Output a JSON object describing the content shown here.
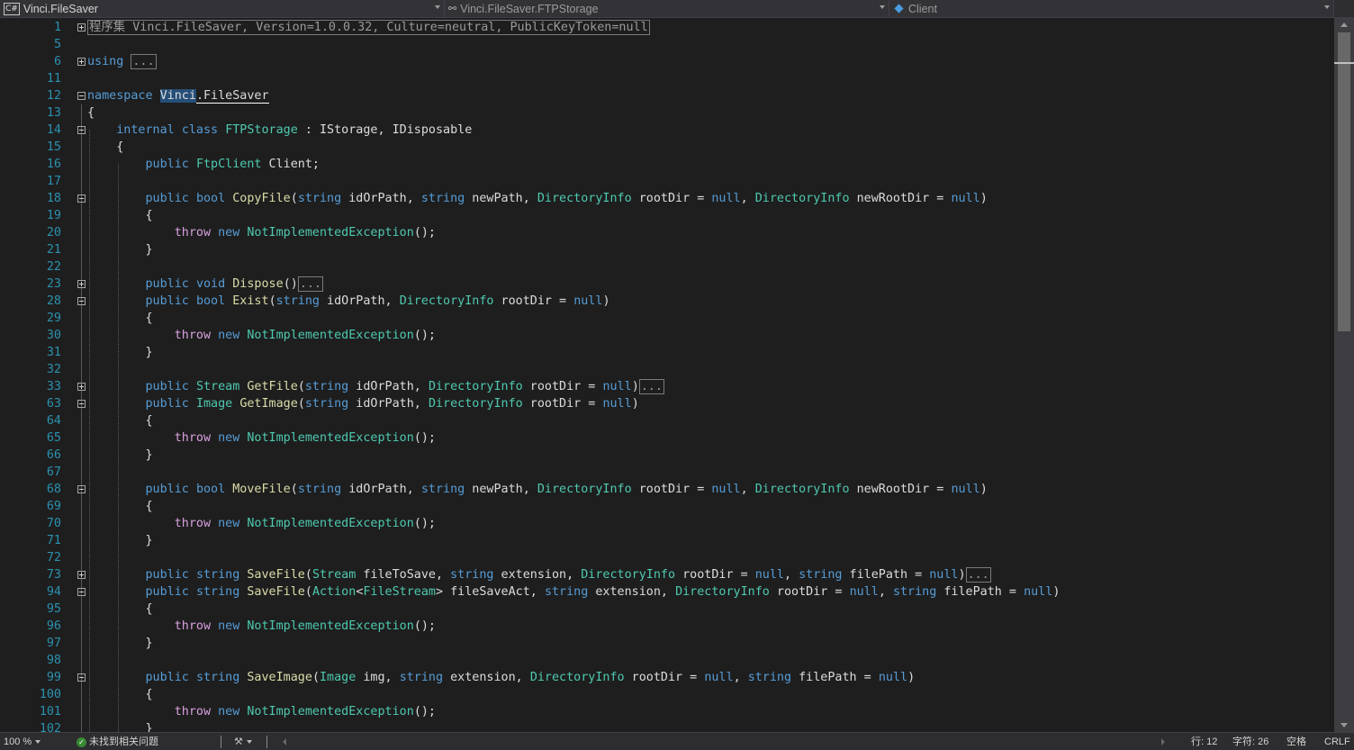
{
  "nav": {
    "project": "Vinci.FileSaver",
    "type": "Vinci.FileSaver.FTPStorage",
    "member": "Client",
    "project_icon": "csharp-project-icon",
    "type_icon": "class-icon",
    "member_icon": "field-icon"
  },
  "code_lines": [
    {
      "n": "1",
      "fold": "plus",
      "tokens": [
        {
          "t": "程序集 Vinci.FileSaver, Version=1.0.0.32, Culture=neutral, PublicKeyToken=null",
          "c": "box"
        }
      ]
    },
    {
      "n": "5",
      "tokens": []
    },
    {
      "n": "6",
      "fold": "plus",
      "tokens": [
        {
          "t": "using",
          "c": "kw"
        },
        {
          "t": " ",
          "c": "plain"
        },
        {
          "t": "...",
          "c": "box"
        }
      ]
    },
    {
      "n": "11",
      "tokens": []
    },
    {
      "n": "12",
      "fold": "minus",
      "tokens": [
        {
          "t": "namespace",
          "c": "kw"
        },
        {
          "t": " ",
          "c": "plain"
        },
        {
          "t": "Vinci",
          "c": "sel"
        },
        {
          "t": ".FileSaver",
          "c": "selb"
        }
      ]
    },
    {
      "n": "13",
      "tokens": [
        {
          "t": "{",
          "c": "plain"
        }
      ]
    },
    {
      "n": "14",
      "fold": "minus",
      "tokens": [
        {
          "t": "    ",
          "c": "plain"
        },
        {
          "t": "internal",
          "c": "kw"
        },
        {
          "t": " ",
          "c": "plain"
        },
        {
          "t": "class",
          "c": "kw"
        },
        {
          "t": " ",
          "c": "plain"
        },
        {
          "t": "FTPStorage",
          "c": "ty"
        },
        {
          "t": " : ",
          "c": "plain"
        },
        {
          "t": "IStorage",
          "c": "txt"
        },
        {
          "t": ", ",
          "c": "plain"
        },
        {
          "t": "IDisposable",
          "c": "txt"
        }
      ]
    },
    {
      "n": "15",
      "tokens": [
        {
          "t": "    {",
          "c": "plain"
        }
      ]
    },
    {
      "n": "16",
      "tokens": [
        {
          "t": "        ",
          "c": "plain"
        },
        {
          "t": "public",
          "c": "kw"
        },
        {
          "t": " ",
          "c": "plain"
        },
        {
          "t": "FtpClient",
          "c": "ty"
        },
        {
          "t": " Client;",
          "c": "plain"
        }
      ]
    },
    {
      "n": "17",
      "tokens": []
    },
    {
      "n": "18",
      "fold": "minus",
      "tokens": [
        {
          "t": "        ",
          "c": "plain"
        },
        {
          "t": "public",
          "c": "kw"
        },
        {
          "t": " ",
          "c": "plain"
        },
        {
          "t": "bool",
          "c": "kw"
        },
        {
          "t": " ",
          "c": "plain"
        },
        {
          "t": "CopyFile",
          "c": "fn"
        },
        {
          "t": "(",
          "c": "plain"
        },
        {
          "t": "string",
          "c": "kw"
        },
        {
          "t": " idOrPath, ",
          "c": "plain"
        },
        {
          "t": "string",
          "c": "kw"
        },
        {
          "t": " newPath, ",
          "c": "plain"
        },
        {
          "t": "DirectoryInfo",
          "c": "ty"
        },
        {
          "t": " rootDir = ",
          "c": "plain"
        },
        {
          "t": "null",
          "c": "kw"
        },
        {
          "t": ", ",
          "c": "plain"
        },
        {
          "t": "DirectoryInfo",
          "c": "ty"
        },
        {
          "t": " newRootDir = ",
          "c": "plain"
        },
        {
          "t": "null",
          "c": "kw"
        },
        {
          "t": ")",
          "c": "plain"
        }
      ]
    },
    {
      "n": "19",
      "tokens": [
        {
          "t": "        {",
          "c": "plain"
        }
      ]
    },
    {
      "n": "20",
      "tokens": [
        {
          "t": "            ",
          "c": "plain"
        },
        {
          "t": "throw",
          "c": "ctl"
        },
        {
          "t": " ",
          "c": "plain"
        },
        {
          "t": "new",
          "c": "kw"
        },
        {
          "t": " ",
          "c": "plain"
        },
        {
          "t": "NotImplementedException",
          "c": "ty"
        },
        {
          "t": "();",
          "c": "plain"
        }
      ]
    },
    {
      "n": "21",
      "tokens": [
        {
          "t": "        }",
          "c": "plain"
        }
      ]
    },
    {
      "n": "22",
      "tokens": []
    },
    {
      "n": "23",
      "fold": "plus",
      "tokens": [
        {
          "t": "        ",
          "c": "plain"
        },
        {
          "t": "public",
          "c": "kw"
        },
        {
          "t": " ",
          "c": "plain"
        },
        {
          "t": "void",
          "c": "kw"
        },
        {
          "t": " ",
          "c": "plain"
        },
        {
          "t": "Dispose",
          "c": "fn"
        },
        {
          "t": "()",
          "c": "plain"
        },
        {
          "t": "...",
          "c": "box"
        }
      ]
    },
    {
      "n": "28",
      "fold": "minus",
      "tokens": [
        {
          "t": "        ",
          "c": "plain"
        },
        {
          "t": "public",
          "c": "kw"
        },
        {
          "t": " ",
          "c": "plain"
        },
        {
          "t": "bool",
          "c": "kw"
        },
        {
          "t": " ",
          "c": "plain"
        },
        {
          "t": "Exist",
          "c": "fn"
        },
        {
          "t": "(",
          "c": "plain"
        },
        {
          "t": "string",
          "c": "kw"
        },
        {
          "t": " idOrPath, ",
          "c": "plain"
        },
        {
          "t": "DirectoryInfo",
          "c": "ty"
        },
        {
          "t": " rootDir = ",
          "c": "plain"
        },
        {
          "t": "null",
          "c": "kw"
        },
        {
          "t": ")",
          "c": "plain"
        }
      ]
    },
    {
      "n": "29",
      "tokens": [
        {
          "t": "        {",
          "c": "plain"
        }
      ]
    },
    {
      "n": "30",
      "tokens": [
        {
          "t": "            ",
          "c": "plain"
        },
        {
          "t": "throw",
          "c": "ctl"
        },
        {
          "t": " ",
          "c": "plain"
        },
        {
          "t": "new",
          "c": "kw"
        },
        {
          "t": " ",
          "c": "plain"
        },
        {
          "t": "NotImplementedException",
          "c": "ty"
        },
        {
          "t": "();",
          "c": "plain"
        }
      ]
    },
    {
      "n": "31",
      "tokens": [
        {
          "t": "        }",
          "c": "plain"
        }
      ]
    },
    {
      "n": "32",
      "tokens": []
    },
    {
      "n": "33",
      "fold": "plus",
      "tokens": [
        {
          "t": "        ",
          "c": "plain"
        },
        {
          "t": "public",
          "c": "kw"
        },
        {
          "t": " ",
          "c": "plain"
        },
        {
          "t": "Stream",
          "c": "ty"
        },
        {
          "t": " ",
          "c": "plain"
        },
        {
          "t": "GetFile",
          "c": "fn"
        },
        {
          "t": "(",
          "c": "plain"
        },
        {
          "t": "string",
          "c": "kw"
        },
        {
          "t": " idOrPath, ",
          "c": "plain"
        },
        {
          "t": "DirectoryInfo",
          "c": "ty"
        },
        {
          "t": " rootDir = ",
          "c": "plain"
        },
        {
          "t": "null",
          "c": "kw"
        },
        {
          "t": ")",
          "c": "plain"
        },
        {
          "t": "...",
          "c": "box"
        }
      ]
    },
    {
      "n": "63",
      "fold": "minus",
      "tokens": [
        {
          "t": "        ",
          "c": "plain"
        },
        {
          "t": "public",
          "c": "kw"
        },
        {
          "t": " ",
          "c": "plain"
        },
        {
          "t": "Image",
          "c": "ty"
        },
        {
          "t": " ",
          "c": "plain"
        },
        {
          "t": "GetImage",
          "c": "fn"
        },
        {
          "t": "(",
          "c": "plain"
        },
        {
          "t": "string",
          "c": "kw"
        },
        {
          "t": " idOrPath, ",
          "c": "plain"
        },
        {
          "t": "DirectoryInfo",
          "c": "ty"
        },
        {
          "t": " rootDir = ",
          "c": "plain"
        },
        {
          "t": "null",
          "c": "kw"
        },
        {
          "t": ")",
          "c": "plain"
        }
      ]
    },
    {
      "n": "64",
      "tokens": [
        {
          "t": "        {",
          "c": "plain"
        }
      ]
    },
    {
      "n": "65",
      "tokens": [
        {
          "t": "            ",
          "c": "plain"
        },
        {
          "t": "throw",
          "c": "ctl"
        },
        {
          "t": " ",
          "c": "plain"
        },
        {
          "t": "new",
          "c": "kw"
        },
        {
          "t": " ",
          "c": "plain"
        },
        {
          "t": "NotImplementedException",
          "c": "ty"
        },
        {
          "t": "();",
          "c": "plain"
        }
      ]
    },
    {
      "n": "66",
      "tokens": [
        {
          "t": "        }",
          "c": "plain"
        }
      ]
    },
    {
      "n": "67",
      "tokens": []
    },
    {
      "n": "68",
      "fold": "minus",
      "tokens": [
        {
          "t": "        ",
          "c": "plain"
        },
        {
          "t": "public",
          "c": "kw"
        },
        {
          "t": " ",
          "c": "plain"
        },
        {
          "t": "bool",
          "c": "kw"
        },
        {
          "t": " ",
          "c": "plain"
        },
        {
          "t": "MoveFile",
          "c": "fn"
        },
        {
          "t": "(",
          "c": "plain"
        },
        {
          "t": "string",
          "c": "kw"
        },
        {
          "t": " idOrPath, ",
          "c": "plain"
        },
        {
          "t": "string",
          "c": "kw"
        },
        {
          "t": " newPath, ",
          "c": "plain"
        },
        {
          "t": "DirectoryInfo",
          "c": "ty"
        },
        {
          "t": " rootDir = ",
          "c": "plain"
        },
        {
          "t": "null",
          "c": "kw"
        },
        {
          "t": ", ",
          "c": "plain"
        },
        {
          "t": "DirectoryInfo",
          "c": "ty"
        },
        {
          "t": " newRootDir = ",
          "c": "plain"
        },
        {
          "t": "null",
          "c": "kw"
        },
        {
          "t": ")",
          "c": "plain"
        }
      ]
    },
    {
      "n": "69",
      "tokens": [
        {
          "t": "        {",
          "c": "plain"
        }
      ]
    },
    {
      "n": "70",
      "tokens": [
        {
          "t": "            ",
          "c": "plain"
        },
        {
          "t": "throw",
          "c": "ctl"
        },
        {
          "t": " ",
          "c": "plain"
        },
        {
          "t": "new",
          "c": "kw"
        },
        {
          "t": " ",
          "c": "plain"
        },
        {
          "t": "NotImplementedException",
          "c": "ty"
        },
        {
          "t": "();",
          "c": "plain"
        }
      ]
    },
    {
      "n": "71",
      "tokens": [
        {
          "t": "        }",
          "c": "plain"
        }
      ]
    },
    {
      "n": "72",
      "tokens": []
    },
    {
      "n": "73",
      "fold": "plus",
      "tokens": [
        {
          "t": "        ",
          "c": "plain"
        },
        {
          "t": "public",
          "c": "kw"
        },
        {
          "t": " ",
          "c": "plain"
        },
        {
          "t": "string",
          "c": "kw"
        },
        {
          "t": " ",
          "c": "plain"
        },
        {
          "t": "SaveFile",
          "c": "fn"
        },
        {
          "t": "(",
          "c": "plain"
        },
        {
          "t": "Stream",
          "c": "ty"
        },
        {
          "t": " fileToSave, ",
          "c": "plain"
        },
        {
          "t": "string",
          "c": "kw"
        },
        {
          "t": " extension, ",
          "c": "plain"
        },
        {
          "t": "DirectoryInfo",
          "c": "ty"
        },
        {
          "t": " rootDir = ",
          "c": "plain"
        },
        {
          "t": "null",
          "c": "kw"
        },
        {
          "t": ", ",
          "c": "plain"
        },
        {
          "t": "string",
          "c": "kw"
        },
        {
          "t": " filePath = ",
          "c": "plain"
        },
        {
          "t": "null",
          "c": "kw"
        },
        {
          "t": ")",
          "c": "plain"
        },
        {
          "t": "...",
          "c": "box"
        }
      ]
    },
    {
      "n": "94",
      "fold": "minus",
      "tokens": [
        {
          "t": "        ",
          "c": "plain"
        },
        {
          "t": "public",
          "c": "kw"
        },
        {
          "t": " ",
          "c": "plain"
        },
        {
          "t": "string",
          "c": "kw"
        },
        {
          "t": " ",
          "c": "plain"
        },
        {
          "t": "SaveFile",
          "c": "fn"
        },
        {
          "t": "(",
          "c": "plain"
        },
        {
          "t": "Action",
          "c": "ty"
        },
        {
          "t": "<",
          "c": "plain"
        },
        {
          "t": "FileStream",
          "c": "ty"
        },
        {
          "t": "> fileSaveAct, ",
          "c": "plain"
        },
        {
          "t": "string",
          "c": "kw"
        },
        {
          "t": " extension, ",
          "c": "plain"
        },
        {
          "t": "DirectoryInfo",
          "c": "ty"
        },
        {
          "t": " rootDir = ",
          "c": "plain"
        },
        {
          "t": "null",
          "c": "kw"
        },
        {
          "t": ", ",
          "c": "plain"
        },
        {
          "t": "string",
          "c": "kw"
        },
        {
          "t": " filePath = ",
          "c": "plain"
        },
        {
          "t": "null",
          "c": "kw"
        },
        {
          "t": ")",
          "c": "plain"
        }
      ]
    },
    {
      "n": "95",
      "tokens": [
        {
          "t": "        {",
          "c": "plain"
        }
      ]
    },
    {
      "n": "96",
      "tokens": [
        {
          "t": "            ",
          "c": "plain"
        },
        {
          "t": "throw",
          "c": "ctl"
        },
        {
          "t": " ",
          "c": "plain"
        },
        {
          "t": "new",
          "c": "kw"
        },
        {
          "t": " ",
          "c": "plain"
        },
        {
          "t": "NotImplementedException",
          "c": "ty"
        },
        {
          "t": "();",
          "c": "plain"
        }
      ]
    },
    {
      "n": "97",
      "tokens": [
        {
          "t": "        }",
          "c": "plain"
        }
      ]
    },
    {
      "n": "98",
      "tokens": []
    },
    {
      "n": "99",
      "fold": "minus",
      "tokens": [
        {
          "t": "        ",
          "c": "plain"
        },
        {
          "t": "public",
          "c": "kw"
        },
        {
          "t": " ",
          "c": "plain"
        },
        {
          "t": "string",
          "c": "kw"
        },
        {
          "t": " ",
          "c": "plain"
        },
        {
          "t": "SaveImage",
          "c": "fn"
        },
        {
          "t": "(",
          "c": "plain"
        },
        {
          "t": "Image",
          "c": "ty"
        },
        {
          "t": " img, ",
          "c": "plain"
        },
        {
          "t": "string",
          "c": "kw"
        },
        {
          "t": " extension, ",
          "c": "plain"
        },
        {
          "t": "DirectoryInfo",
          "c": "ty"
        },
        {
          "t": " rootDir = ",
          "c": "plain"
        },
        {
          "t": "null",
          "c": "kw"
        },
        {
          "t": ", ",
          "c": "plain"
        },
        {
          "t": "string",
          "c": "kw"
        },
        {
          "t": " filePath = ",
          "c": "plain"
        },
        {
          "t": "null",
          "c": "kw"
        },
        {
          "t": ")",
          "c": "plain"
        }
      ]
    },
    {
      "n": "100",
      "tokens": [
        {
          "t": "        {",
          "c": "plain"
        }
      ]
    },
    {
      "n": "101",
      "tokens": [
        {
          "t": "            ",
          "c": "plain"
        },
        {
          "t": "throw",
          "c": "ctl"
        },
        {
          "t": " ",
          "c": "plain"
        },
        {
          "t": "new",
          "c": "kw"
        },
        {
          "t": " ",
          "c": "plain"
        },
        {
          "t": "NotImplementedException",
          "c": "ty"
        },
        {
          "t": "();",
          "c": "plain"
        }
      ]
    },
    {
      "n": "102",
      "tokens": [
        {
          "t": "        }",
          "c": "plain"
        }
      ]
    }
  ],
  "status": {
    "zoom": "100 %",
    "issues": "未找到相关问题",
    "line": "行: 12",
    "char": "字符: 26",
    "indent": "空格",
    "eol": "CRLF"
  },
  "colors": {
    "background": "#1e1e1e",
    "keyword": "#569cd6",
    "type": "#4ec9b0",
    "line_number": "#2b91af",
    "method": "#dcdcaa",
    "selection": "#264f78"
  }
}
